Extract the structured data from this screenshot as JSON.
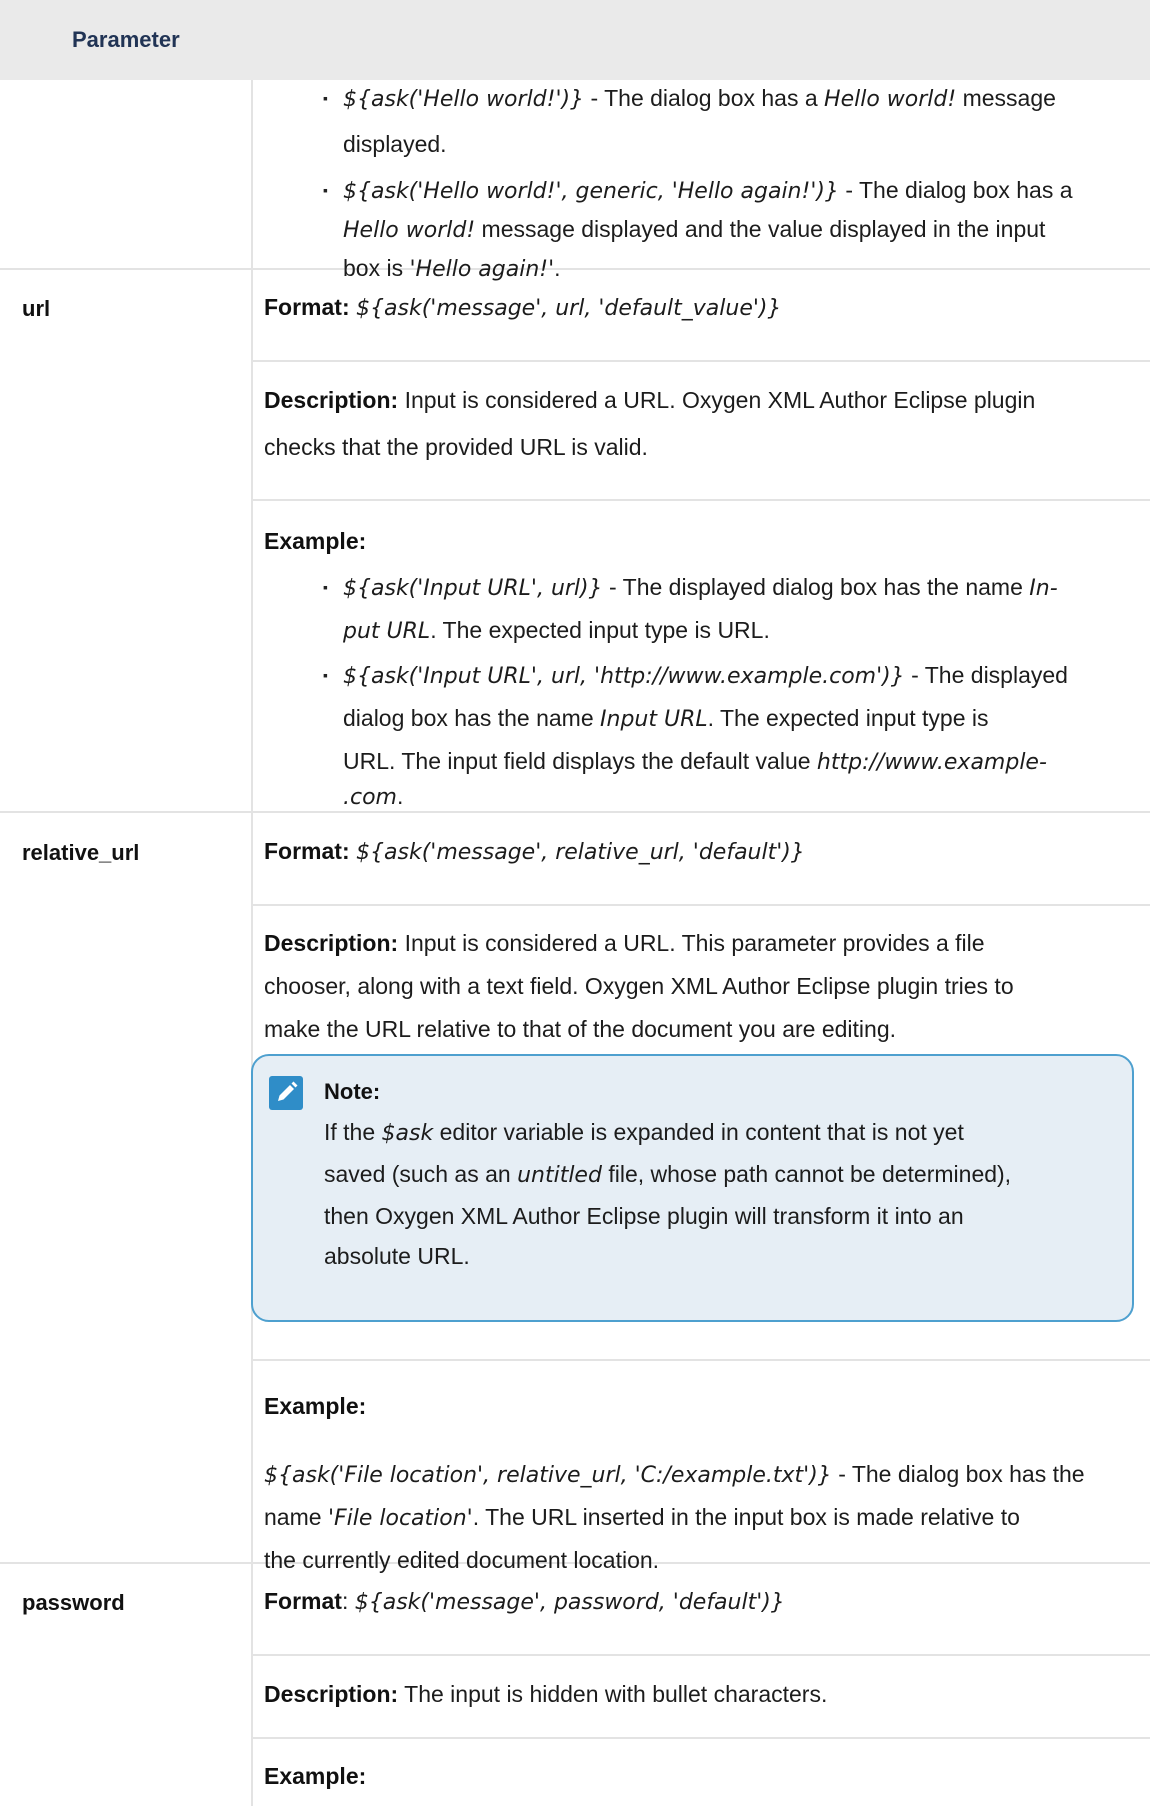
{
  "header": {
    "column_title": "Parameter"
  },
  "continuation": {
    "b1_code": "${ask('Hello world!')}",
    "b1_sep": " - The dialog box has a ",
    "b1_em": "Hello world!",
    "b1_end": " message",
    "b1_line2": "displayed.",
    "b2_code": "${ask('Hello world!', generic, 'Hello again!')}",
    "b2_sep": " - The dialog box has a",
    "b2_l2_em": "Hello world!",
    "b2_l2_rest": " message displayed and the value displayed in the input",
    "b2_l3_a": "box is ",
    "b2_l3_em": "'Hello again!'",
    "b2_l3_end": "."
  },
  "url": {
    "name": "url",
    "format_label": "Format:",
    "format_code": "${ask('message', url, 'default_value')}",
    "desc_label": "Description:",
    "desc_l1": " Input is considered a URL. Oxygen XML Author Eclipse plugin",
    "desc_l2": "checks that the provided URL is valid.",
    "example_label": "Example:",
    "ex1_code": "${ask('Input URL', url)}",
    "ex1_text": " - The displayed dialog box has the name ",
    "ex1_em1": "In-",
    "ex1_l2_em": "put URL",
    "ex1_l2_rest": ". The expected input type is URL.",
    "ex2_code": "${ask('Input URL', url, 'http://www.example.com')}",
    "ex2_text": " - The displayed",
    "ex2_l2_a": "dialog box has the name ",
    "ex2_l2_em": "Input URL",
    "ex2_l2_b": ". The expected input type is",
    "ex2_l3_a": "URL. The input field displays the default value ",
    "ex2_l3_em": "http://www.example-",
    "ex2_l4_em": ".com",
    "ex2_l4_end": "."
  },
  "relative_url": {
    "name": "relative_url",
    "format_label": "Format:",
    "format_code": "${ask('message', relative_url, 'default')}",
    "desc_label": "Description:",
    "desc_l1": " Input is considered a URL. This parameter provides a file",
    "desc_l2": "chooser, along with a text field. Oxygen XML Author Eclipse plugin tries to",
    "desc_l3": "make the URL relative to that of the document you are editing.",
    "note_title": "Note:",
    "note_l1_a": "If the ",
    "note_l1_em": "$ask",
    "note_l1_b": " editor variable is expanded in content that is not yet",
    "note_l2_a": "saved (such as an ",
    "note_l2_em": "untitled",
    "note_l2_b": " file, whose path cannot be determined),",
    "note_l3": "then Oxygen XML Author Eclipse plugin will transform it into an",
    "note_l4": "absolute URL.",
    "example_label": "Example:",
    "ex_code": "${ask('File location', relative_url, 'C:/example.txt')}",
    "ex_text": " - The dialog box has the",
    "ex_l2_a": "name ",
    "ex_l2_em": "'File location'",
    "ex_l2_b": ". The URL inserted in the input box is made relative to",
    "ex_l3": "the currently edited document location."
  },
  "password": {
    "name": "password",
    "format_label": "Format",
    "format_colon": ": ",
    "format_code": "${ask('message', password, 'default')}",
    "desc_label": "Description:",
    "desc_text": " The input is hidden with bullet characters.",
    "example_label": "Example:"
  },
  "icons": {
    "note": "pencil-note-icon",
    "bullet": "square-bullet"
  },
  "colors": {
    "header_bg": "#eaeaea",
    "header_text": "#213455",
    "note_bg": "#e6eef5",
    "note_border": "#4ea0cf",
    "note_icon": "#2f8dc8"
  }
}
